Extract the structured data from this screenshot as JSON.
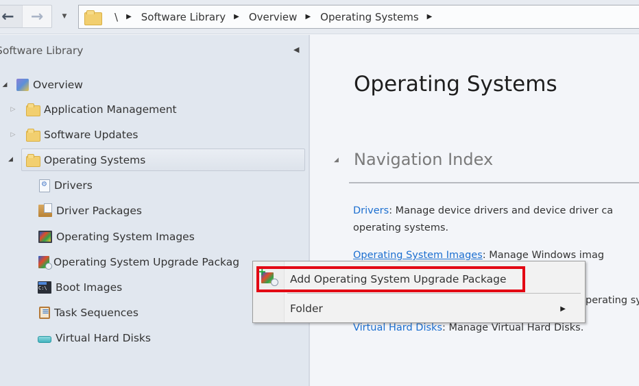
{
  "toolbar": {
    "back_icon": "←",
    "forward_icon": "→",
    "history_dropdown_icon": "▼",
    "breadcrumb": [
      "\\",
      "Software Library",
      "Overview",
      "Operating Systems"
    ],
    "breadcrumb_separator": "▶"
  },
  "sidebar": {
    "title": "Software Library",
    "collapse_icon": "◀",
    "tree": [
      {
        "label": "Overview",
        "icon": "overview-icon",
        "expander": "◢",
        "level": 0
      },
      {
        "label": "Application Management",
        "icon": "folder-icon",
        "expander": "▷",
        "level": 1
      },
      {
        "label": "Software Updates",
        "icon": "folder-icon",
        "expander": "▷",
        "level": 1
      },
      {
        "label": "Operating Systems",
        "icon": "folder-icon",
        "expander": "◢",
        "level": 1,
        "selected": true
      },
      {
        "label": "Drivers",
        "icon": "drivers-icon",
        "level": 2
      },
      {
        "label": "Driver Packages",
        "icon": "driver-packages-icon",
        "level": 2
      },
      {
        "label": "Operating System Images",
        "icon": "os-images-icon",
        "level": 2
      },
      {
        "label": "Operating System Upgrade Packag",
        "icon": "os-upgrade-packages-icon",
        "level": 2
      },
      {
        "label": "Boot Images",
        "icon": "boot-images-icon",
        "level": 2
      },
      {
        "label": "Task Sequences",
        "icon": "task-sequences-icon",
        "level": 2
      },
      {
        "label": "Virtual Hard Disks",
        "icon": "virtual-hard-disks-icon",
        "level": 2
      }
    ]
  },
  "main": {
    "title": "Operating Systems",
    "section_toggle_icon": "◢",
    "section_title": "Navigation Index",
    "descriptions": [
      {
        "link": "Drivers",
        "text": ": Manage device drivers and device driver ca",
        "continuation": "operating systems."
      },
      {
        "link": "Operating System Images",
        "text": ": Manage Windows imag"
      },
      {
        "link": "",
        "text": "perating sy"
      },
      {
        "link": "Virtual Hard Disks",
        "text": ": Manage Virtual Hard Disks."
      }
    ]
  },
  "context_menu": {
    "items": [
      {
        "label": "Add Operating System Upgrade Package",
        "icon": "add-upgrade-package-icon",
        "highlighted": true
      },
      {
        "label": "Folder",
        "submenu_icon": "▶"
      }
    ],
    "highlight_color": "#e30613"
  },
  "colors": {
    "link": "#1c6fd0",
    "sidebar_bg": "#e1e7ef",
    "content_bg": "#f3f5f9",
    "highlight_box": "#e30613"
  }
}
